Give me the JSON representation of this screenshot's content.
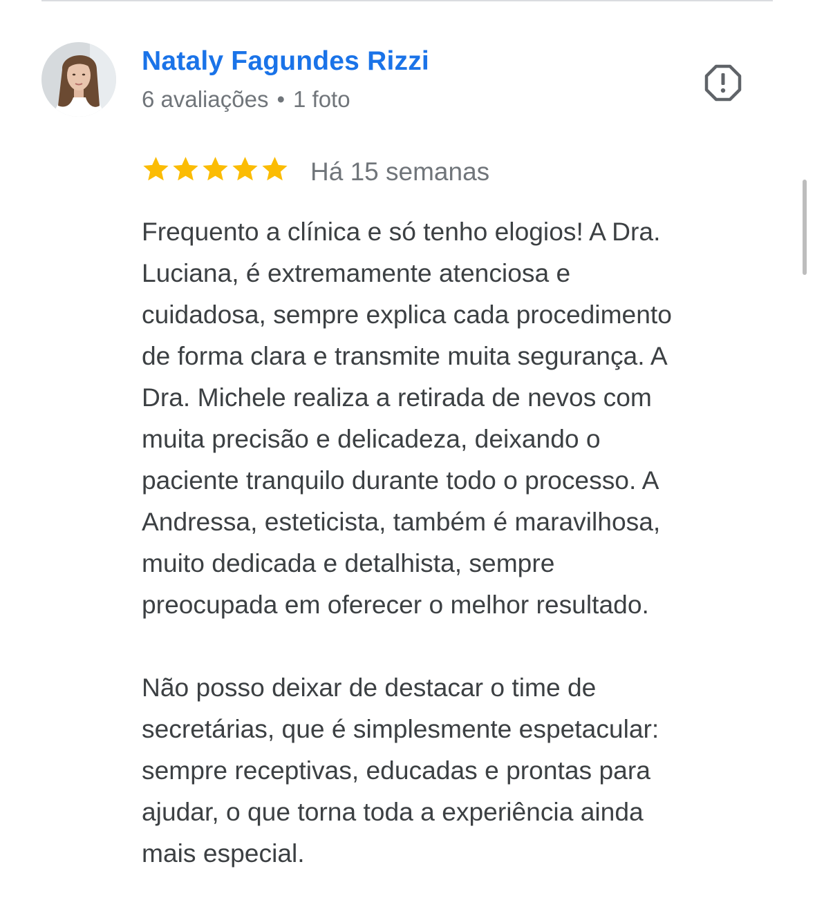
{
  "review": {
    "reviewer_name": "Nataly Fagundes Rizzi",
    "reviewer_reviews": "6 avaliações",
    "separator": "•",
    "reviewer_photos": "1 foto",
    "rating": 5,
    "rating_max": 5,
    "date": "Há 15 semanas",
    "paragraphs": [
      "Frequento a clínica e só tenho elogios! A Dra.\nLuciana, é extremamente atenciosa e\ncuidadosa, sempre explica cada procedimento\nde forma clara e transmite muita segurança. A\nDra. Michele realiza a retirada de nevos com\nmuita precisão e delicadeza, deixando o\npaciente tranquilo durante todo o processo. A\nAndressa, esteticista, também é maravilhosa,\nmuito dedicada e detalhista, sempre\npreocupada em oferecer o melhor resultado.",
      "Não posso deixar de destacar o time de\nsecretárias, que é simplesmente espetacular:\nsempre receptivas, educadas e prontas para\najudar, o que torna toda a experiência ainda\nmais especial."
    ]
  },
  "icons": {
    "report": "report-icon",
    "star": "star-icon"
  },
  "colors": {
    "name": "#1a73e8",
    "star": "#fbbc04",
    "meta": "#70757a",
    "text": "#3c4043",
    "icon": "#5f6368"
  }
}
